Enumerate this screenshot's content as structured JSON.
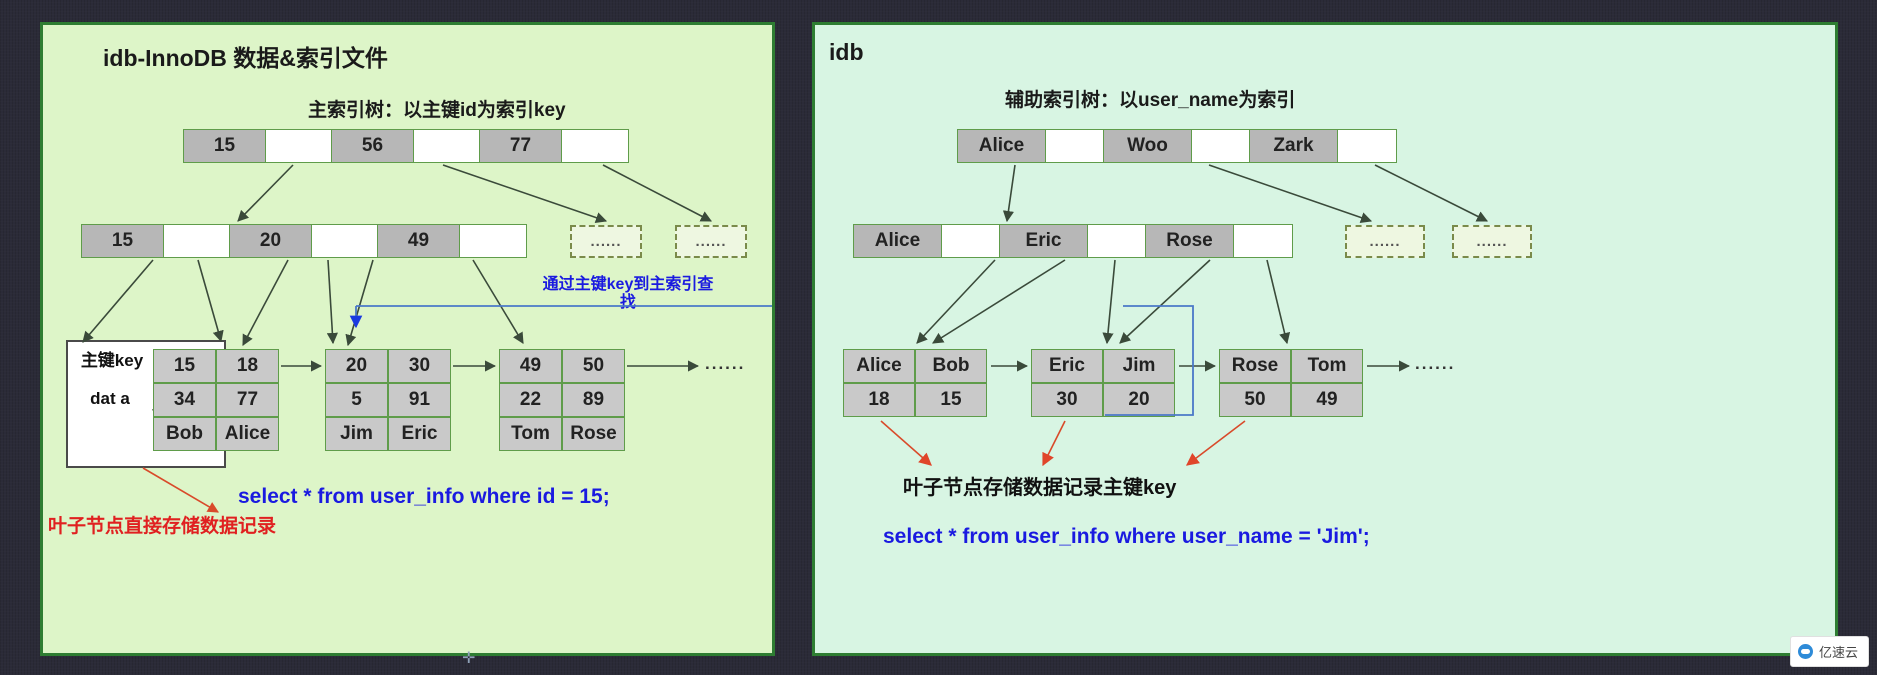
{
  "left_panel": {
    "title": "idb-InnoDB 数据&索引文件",
    "tree_title": "主索引树：以主键id为索引key",
    "root_node": {
      "keys": [
        "15",
        "56",
        "77"
      ]
    },
    "internal_node": {
      "keys": [
        "15",
        "20",
        "49"
      ]
    },
    "dashed_nodes": [
      "......",
      "......"
    ],
    "leaf_nodes": [
      {
        "keys": [
          "15",
          "18"
        ],
        "row2": [
          "34",
          "77"
        ],
        "row3": [
          "Bob",
          "Alice"
        ]
      },
      {
        "keys": [
          "20",
          "30"
        ],
        "row2": [
          "5",
          "91"
        ],
        "row3": [
          "Jim",
          "Eric"
        ]
      },
      {
        "keys": [
          "49",
          "50"
        ],
        "row2": [
          "22",
          "89"
        ],
        "row3": [
          "Tom",
          "Rose"
        ]
      }
    ],
    "leaf_tail_ellipsis": "......",
    "frame_label_key": "主键key",
    "frame_label_data": "dat\na",
    "note_red": "叶子节点直接存储数据记录",
    "note_sql": "select  * from user_info  where id = 15;",
    "note_lookup": "通过主键key到主索引查\n找"
  },
  "right_panel": {
    "title": "idb",
    "tree_title": "辅助索引树：以user_name为索引",
    "root_node": {
      "keys": [
        "Alice",
        "Woo",
        "Zark"
      ]
    },
    "internal_node": {
      "keys": [
        "Alice",
        "Eric",
        "Rose"
      ]
    },
    "dashed_nodes": [
      "......",
      "......"
    ],
    "leaf_nodes": [
      {
        "keys": [
          "Alice",
          "Bob"
        ],
        "row2": [
          "18",
          "15"
        ]
      },
      {
        "keys": [
          "Eric",
          "Jim"
        ],
        "row2": [
          "30",
          "20"
        ]
      },
      {
        "keys": [
          "Rose",
          "Tom"
        ],
        "row2": [
          "50",
          "49"
        ]
      }
    ],
    "leaf_tail_ellipsis": "......",
    "note_black": "叶子节点存储数据记录主键key",
    "note_sql": "select  * from user_info  where user_name = 'Jim';"
  },
  "watermark": {
    "text": "亿速云"
  },
  "colors": {
    "panel_left_bg": "#ddf5c8",
    "panel_right_bg": "#d8f5e3",
    "panel_border": "#2e7d32",
    "key_cell": "#b7b7b7",
    "leaf_cell": "#c9c9c9",
    "note_blue": "#1a1ae0",
    "note_red": "#e02020",
    "link_blue": "#4a78c8",
    "arrow_dark": "#3a4a3a",
    "arrow_red": "#d94a2a"
  }
}
